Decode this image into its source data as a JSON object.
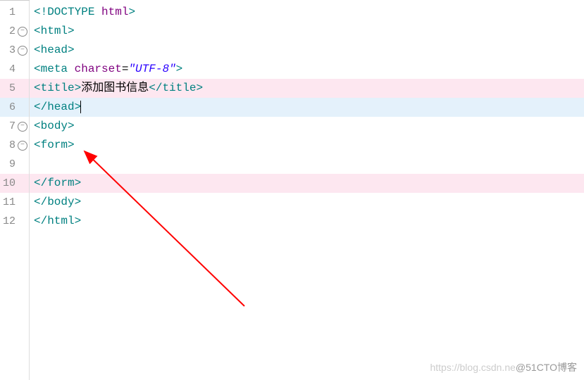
{
  "lines": [
    {
      "num": "1",
      "fold": false,
      "highlight": ""
    },
    {
      "num": "2",
      "fold": true,
      "highlight": ""
    },
    {
      "num": "3",
      "fold": true,
      "highlight": ""
    },
    {
      "num": "4",
      "fold": false,
      "highlight": ""
    },
    {
      "num": "5",
      "fold": false,
      "highlight": "pink"
    },
    {
      "num": "6",
      "fold": false,
      "highlight": "blue"
    },
    {
      "num": "7",
      "fold": true,
      "highlight": ""
    },
    {
      "num": "8",
      "fold": true,
      "highlight": ""
    },
    {
      "num": "9",
      "fold": false,
      "highlight": ""
    },
    {
      "num": "10",
      "fold": false,
      "highlight": "pink"
    },
    {
      "num": "11",
      "fold": false,
      "highlight": ""
    },
    {
      "num": "12",
      "fold": false,
      "highlight": ""
    }
  ],
  "code": {
    "l1": {
      "a": "<!",
      "b": "DOCTYPE",
      "c": " ",
      "d": "html",
      "e": ">"
    },
    "l2": {
      "open": "<",
      "tag": "html",
      "close": ">"
    },
    "l3": {
      "open": "<",
      "tag": "head",
      "close": ">"
    },
    "l4": {
      "open": "<",
      "tag": "meta",
      "sp": " ",
      "attr": "charset",
      "eq": "=",
      "val": "\"UTF-8\"",
      "close": ">"
    },
    "l5": {
      "open": "<",
      "tag": "title",
      "close": ">",
      "text": "添加图书信息",
      "openc": "</",
      "tagc": "title",
      "closec": ">"
    },
    "l6": {
      "open": "</",
      "tag": "head",
      "close": ">"
    },
    "l7": {
      "open": "<",
      "tag": "body",
      "close": ">"
    },
    "l8": {
      "open": "<",
      "tag": "form",
      "close": ">"
    },
    "l10": {
      "open": "</",
      "tag": "form",
      "close": ">"
    },
    "l11": {
      "open": "</",
      "tag": "body",
      "close": ">"
    },
    "l12": {
      "open": "</",
      "tag": "html",
      "close": ">"
    }
  },
  "fold_glyph": "⊖",
  "watermark": {
    "left": "https://blog.csdn.ne",
    "right": "@51CTO博客"
  }
}
